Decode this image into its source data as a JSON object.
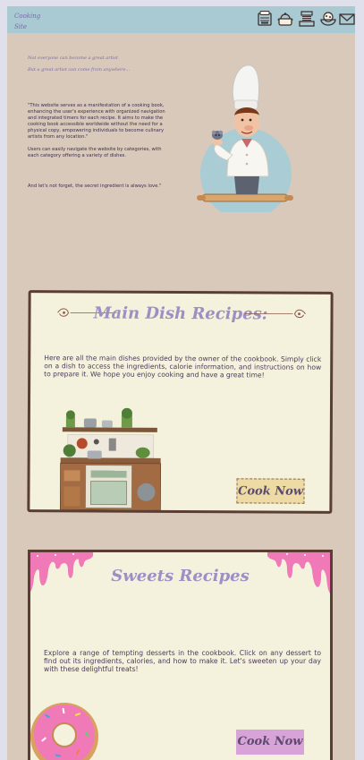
{
  "navbar": {
    "brand_line1": "Cooking",
    "brand_line2": "Site",
    "icons": [
      "recipe-book-icon",
      "cooking-pot-icon",
      "kitchen-appliance-icon",
      "dish-bowl-icon",
      "mail-icon"
    ]
  },
  "hero": {
    "quote_line1": "Not everyone can become a great artist",
    "quote_line2": "But a great artist can come from anywhere...",
    "intro_p1": "\"This website serves as a manifestation of a cooking book, enhancing the user's experience with organized navigation and integrated timers for each recipe. It aims to make the cooking book accessible worldwide without the need for a physical copy, empowering individuals to become culinary artists from any location.\"",
    "intro_p2": "Users can easily navigate the website by categories, with each category offering a variety of dishes.",
    "intro_p3": "And let's not forget, the secret ingredient is always love.\""
  },
  "main_dish": {
    "title": "Main Dish Recipes:",
    "description": "Here are all the main dishes provided by the owner of the cookbook. Simply click on a dish to access the ingredients, calorie information, and instructions on how to prepare it. We hope you enjoy cooking and have a great time!",
    "button_label": "Cook Now"
  },
  "sweets": {
    "title": "Sweets Recipes",
    "description": "Explore a range of tempting desserts in the cookbook. Click on any dessert to find out its ingredients, calories, and how to make it. Let's sweeten up your day with these delightful treats!",
    "button_label": "Cook Now"
  },
  "colors": {
    "navbar": "#a9c9d3",
    "page_bg": "#d9c9bb",
    "card_bg": "#f4f1dc",
    "card_border": "#5a3d33",
    "title": "#9d8fc3",
    "main_button": "#eedba4",
    "sweets_button": "#d7a3d8",
    "drip_pink": "#f07ab8"
  }
}
